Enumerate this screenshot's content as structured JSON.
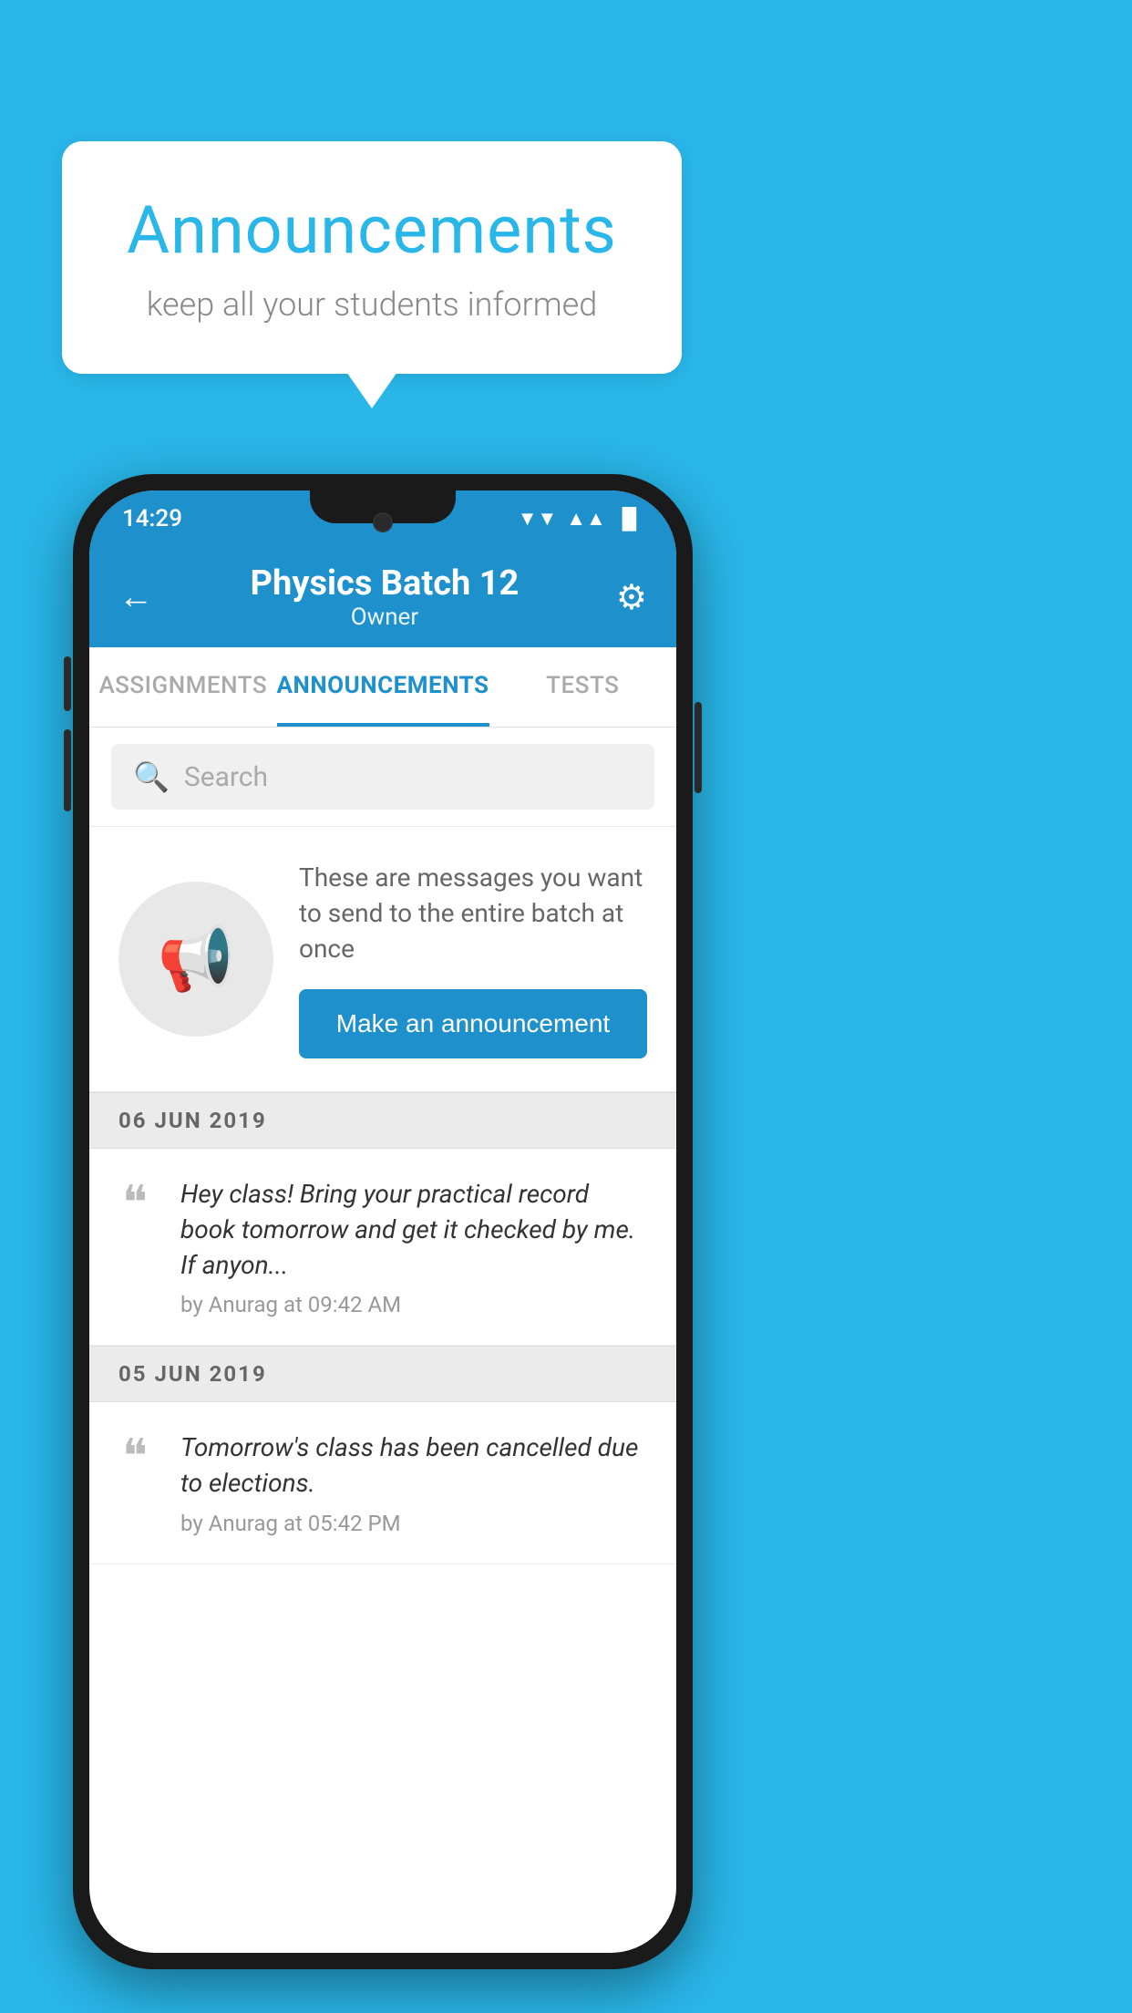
{
  "background_color": "#29b6e8",
  "speech_bubble": {
    "title": "Announcements",
    "subtitle": "keep all your students informed"
  },
  "phone": {
    "status_bar": {
      "time": "14:29",
      "wifi_icon": "▼",
      "signal_icon": "▲",
      "battery_icon": "▐"
    },
    "app_bar": {
      "back_label": "←",
      "title": "Physics Batch 12",
      "subtitle": "Owner",
      "settings_icon": "⚙"
    },
    "tabs": [
      {
        "label": "ASSIGNMENTS",
        "active": false
      },
      {
        "label": "ANNOUNCEMENTS",
        "active": true
      },
      {
        "label": "TESTS",
        "active": false
      }
    ],
    "search": {
      "placeholder": "Search"
    },
    "promo": {
      "text": "These are messages you want to send to the entire batch at once",
      "button_label": "Make an announcement"
    },
    "date_groups": [
      {
        "date": "06  JUN  2019",
        "announcements": [
          {
            "text": "Hey class! Bring your practical record book tomorrow and get it checked by me. If anyon...",
            "meta": "by Anurag at 09:42 AM"
          }
        ]
      },
      {
        "date": "05  JUN  2019",
        "announcements": [
          {
            "text": "Tomorrow's class has been cancelled due to elections.",
            "meta": "by Anurag at 05:42 PM"
          }
        ]
      }
    ]
  }
}
